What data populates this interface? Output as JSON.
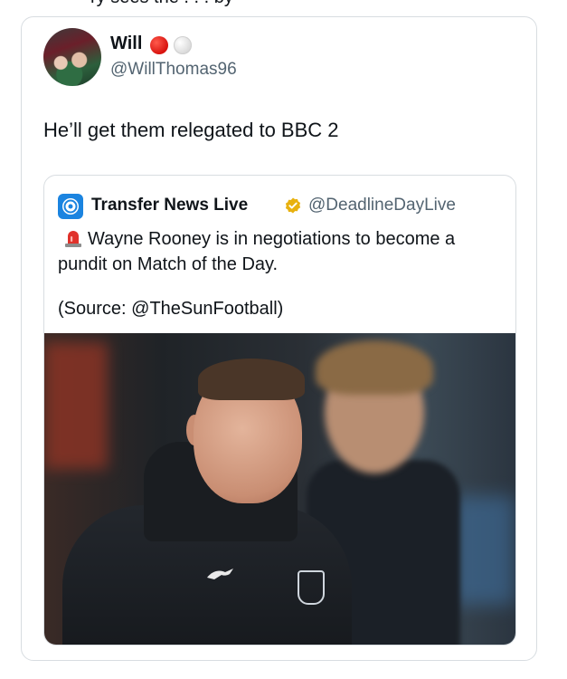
{
  "top_text": "ry sees the . . . by",
  "tweet": {
    "display_name": "Will",
    "name_emojis": [
      "red-circle",
      "white-circle"
    ],
    "handle": "@WillThomas96",
    "text": "He’ll get them relegated to BBC 2"
  },
  "quoted_tweet": {
    "display_name": "Transfer News Live",
    "handle": "@DeadlineDayLive",
    "text": "Wayne Rooney is in negotiations to become a pundit on Match of the Day.",
    "source": "(Source: @TheSunFootball)",
    "lead_emoji": "siren-icon",
    "verified_color": "#e8b10f"
  },
  "colors": {
    "text": "#0f1419",
    "secondary": "#536471",
    "border": "#d8dde1",
    "accent_blue": "#1b84e0"
  }
}
